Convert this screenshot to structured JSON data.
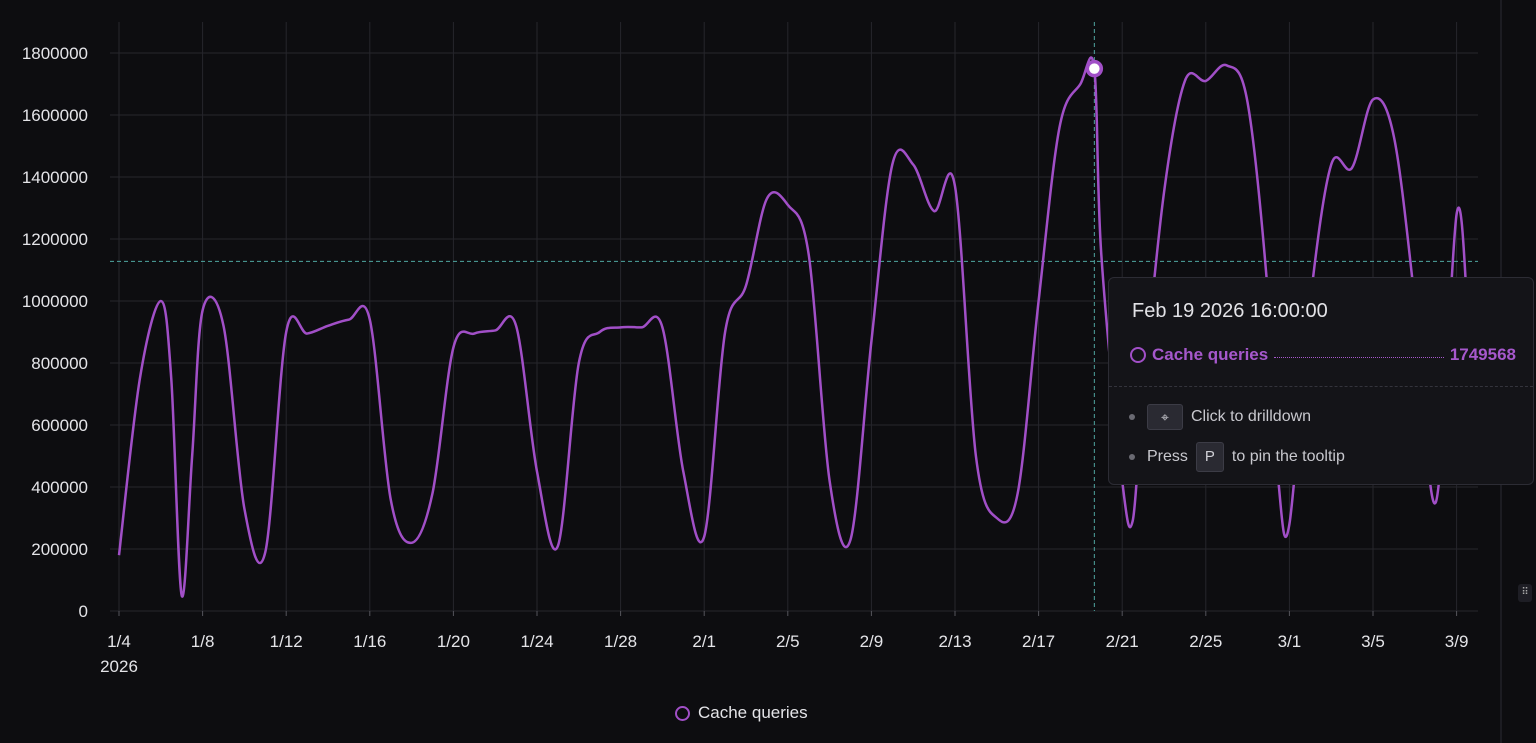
{
  "chart_data": {
    "type": "line",
    "xlabel": "",
    "ylabel": "",
    "ylim": [
      0,
      1900000
    ],
    "y_ticks": [
      "0",
      "200000",
      "400000",
      "600000",
      "800000",
      "1000000",
      "1200000",
      "1400000",
      "1600000",
      "1800000"
    ],
    "x_ticks": [
      "1/4",
      "1/8",
      "1/12",
      "1/16",
      "1/20",
      "1/24",
      "1/28",
      "2/1",
      "2/5",
      "2/9",
      "2/13",
      "2/17",
      "2/21",
      "2/25",
      "3/1",
      "3/5",
      "3/9"
    ],
    "x_year_label": "2026",
    "grid": true,
    "legend_position": "bottom",
    "crosshair_y": 1128000,
    "series": [
      {
        "name": "Cache queries",
        "color": "#a14fc7",
        "points": [
          [
            "1/4",
            180000
          ],
          [
            "1/5",
            750000
          ],
          [
            "1/6",
            1000000
          ],
          [
            "1/6 12:00",
            750000
          ],
          [
            "1/7",
            50000
          ],
          [
            "1/7 12:00",
            500000
          ],
          [
            "1/8",
            970000
          ],
          [
            "1/9",
            920000
          ],
          [
            "1/10",
            330000
          ],
          [
            "1/11",
            190000
          ],
          [
            "1/12",
            900000
          ],
          [
            "1/13",
            895000
          ],
          [
            "1/14",
            920000
          ],
          [
            "1/15",
            940000
          ],
          [
            "1/16",
            940000
          ],
          [
            "1/17",
            360000
          ],
          [
            "1/18",
            220000
          ],
          [
            "1/19",
            380000
          ],
          [
            "1/20",
            850000
          ],
          [
            "1/21",
            895000
          ],
          [
            "1/22",
            905000
          ],
          [
            "1/23",
            920000
          ],
          [
            "1/24",
            450000
          ],
          [
            "1/25",
            210000
          ],
          [
            "1/26",
            800000
          ],
          [
            "1/27",
            900000
          ],
          [
            "1/28",
            915000
          ],
          [
            "1/29",
            915000
          ],
          [
            "1/30",
            915000
          ],
          [
            "1/31",
            450000
          ],
          [
            "2/1",
            240000
          ],
          [
            "2/2",
            900000
          ],
          [
            "2/3",
            1050000
          ],
          [
            "2/4",
            1330000
          ],
          [
            "2/5",
            1310000
          ],
          [
            "2/6",
            1150000
          ],
          [
            "2/7",
            420000
          ],
          [
            "2/8",
            230000
          ],
          [
            "2/9",
            870000
          ],
          [
            "2/10",
            1440000
          ],
          [
            "2/11",
            1440000
          ],
          [
            "2/12",
            1290000
          ],
          [
            "2/13",
            1370000
          ],
          [
            "2/14",
            500000
          ],
          [
            "2/15",
            300000
          ],
          [
            "2/16",
            380000
          ],
          [
            "2/17",
            1000000
          ],
          [
            "2/18",
            1560000
          ],
          [
            "2/19",
            1700000
          ],
          [
            "2/19 16:00",
            1749568
          ],
          [
            "2/20",
            1150000
          ],
          [
            "2/21",
            420000
          ],
          [
            "2/21 12:00",
            290000
          ],
          [
            "2/22",
            700000
          ],
          [
            "2/23",
            1350000
          ],
          [
            "2/24",
            1710000
          ],
          [
            "2/25",
            1710000
          ],
          [
            "2/26",
            1760000
          ],
          [
            "2/27",
            1640000
          ],
          [
            "2/28",
            1000000
          ],
          [
            "2/29",
            400000
          ],
          [
            "3/1",
            280000
          ],
          [
            "3/2",
            1000000
          ],
          [
            "3/3",
            1440000
          ],
          [
            "3/4",
            1430000
          ],
          [
            "3/5",
            1650000
          ],
          [
            "3/6",
            1530000
          ],
          [
            "3/7",
            1000000
          ],
          [
            "3/8",
            350000
          ],
          [
            "3/9",
            1280000
          ],
          [
            "3/9 12:00",
            1000000
          ]
        ]
      }
    ]
  },
  "tooltip": {
    "title": "Feb 19 2026 16:00:00",
    "series_name": "Cache queries",
    "value": "1749568",
    "hint_click": "Click to drilldown",
    "hint_press": "Press",
    "hint_key": "P",
    "hint_pin": "to pin the tooltip"
  },
  "legend": {
    "label": "Cache queries"
  },
  "colors": {
    "series": "#a14fc7",
    "crosshair": "#4fa6a0",
    "grid": "#26262c",
    "background": "#0d0d10"
  }
}
